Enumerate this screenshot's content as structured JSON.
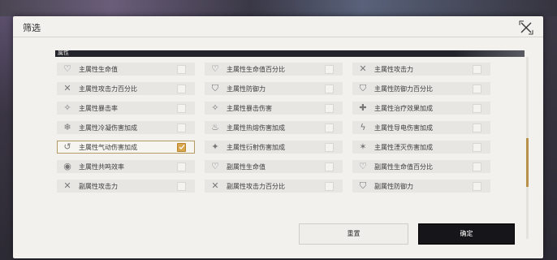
{
  "dialog": {
    "title": "筛选",
    "section_label": "属性",
    "reset_label": "重置",
    "confirm_label": "确定"
  },
  "items": [
    {
      "label": "主属性生命值",
      "icon": "heart-icon",
      "checked": false
    },
    {
      "label": "主属性生命值百分比",
      "icon": "heart-percent-icon",
      "checked": false
    },
    {
      "label": "主属性攻击力",
      "icon": "crossed-swords-icon",
      "checked": false
    },
    {
      "label": "主属性攻击力百分比",
      "icon": "crossed-swords-icon",
      "checked": false
    },
    {
      "label": "主属性防御力",
      "icon": "shield-icon",
      "checked": false
    },
    {
      "label": "主属性防御力百分比",
      "icon": "shield-icon",
      "checked": false
    },
    {
      "label": "主属性暴击率",
      "icon": "crosshair-icon",
      "checked": false
    },
    {
      "label": "主属性暴击伤害",
      "icon": "crosshair-icon",
      "checked": false
    },
    {
      "label": "主属性治疗效果加成",
      "icon": "healing-icon",
      "checked": false
    },
    {
      "label": "主属性冷凝伤害加成",
      "icon": "snowflake-icon",
      "checked": false
    },
    {
      "label": "主属性热熔伤害加成",
      "icon": "flame-icon",
      "checked": false
    },
    {
      "label": "主属性导电伤害加成",
      "icon": "lightning-icon",
      "checked": false
    },
    {
      "label": "主属性气动伤害加成",
      "icon": "wind-icon",
      "checked": true
    },
    {
      "label": "主属性衍射伤害加成",
      "icon": "sparkle-icon",
      "checked": false
    },
    {
      "label": "主属性湮灭伤害加成",
      "icon": "void-icon",
      "checked": false
    },
    {
      "label": "主属性共鸣效率",
      "icon": "resonance-icon",
      "checked": false
    },
    {
      "label": "副属性生命值",
      "icon": "heart-icon",
      "checked": false
    },
    {
      "label": "副属性生命值百分比",
      "icon": "heart-percent-icon",
      "checked": false
    },
    {
      "label": "副属性攻击力",
      "icon": "crossed-swords-icon",
      "checked": false
    },
    {
      "label": "副属性攻击力百分比",
      "icon": "crossed-swords-icon",
      "checked": false
    },
    {
      "label": "副属性防御力",
      "icon": "shield-icon",
      "checked": false
    }
  ],
  "colors": {
    "accent": "#d9a54a",
    "confirm_bg": "#16161a"
  }
}
